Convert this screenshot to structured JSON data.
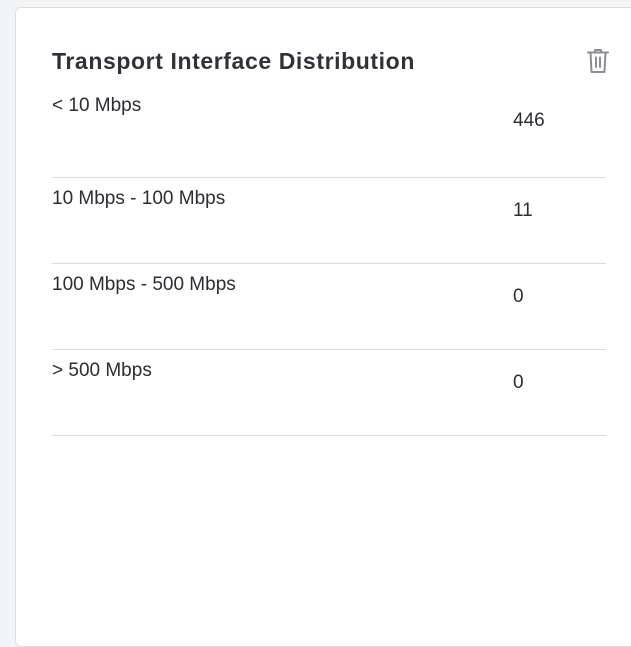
{
  "widget": {
    "title": "Transport Interface Distribution",
    "delete_icon": "trash-icon",
    "rows": [
      {
        "label": "< 10 Mbps",
        "count": "446"
      },
      {
        "label": "10 Mbps - 100 Mbps",
        "count": "11"
      },
      {
        "label": "100 Mbps - 500 Mbps",
        "count": "0"
      },
      {
        "label": "> 500 Mbps",
        "count": "0"
      }
    ]
  },
  "colors": {
    "title": "#30323a",
    "text": "#2b2d33",
    "divider": "#d9dadd",
    "icon": "#8a8d94"
  }
}
